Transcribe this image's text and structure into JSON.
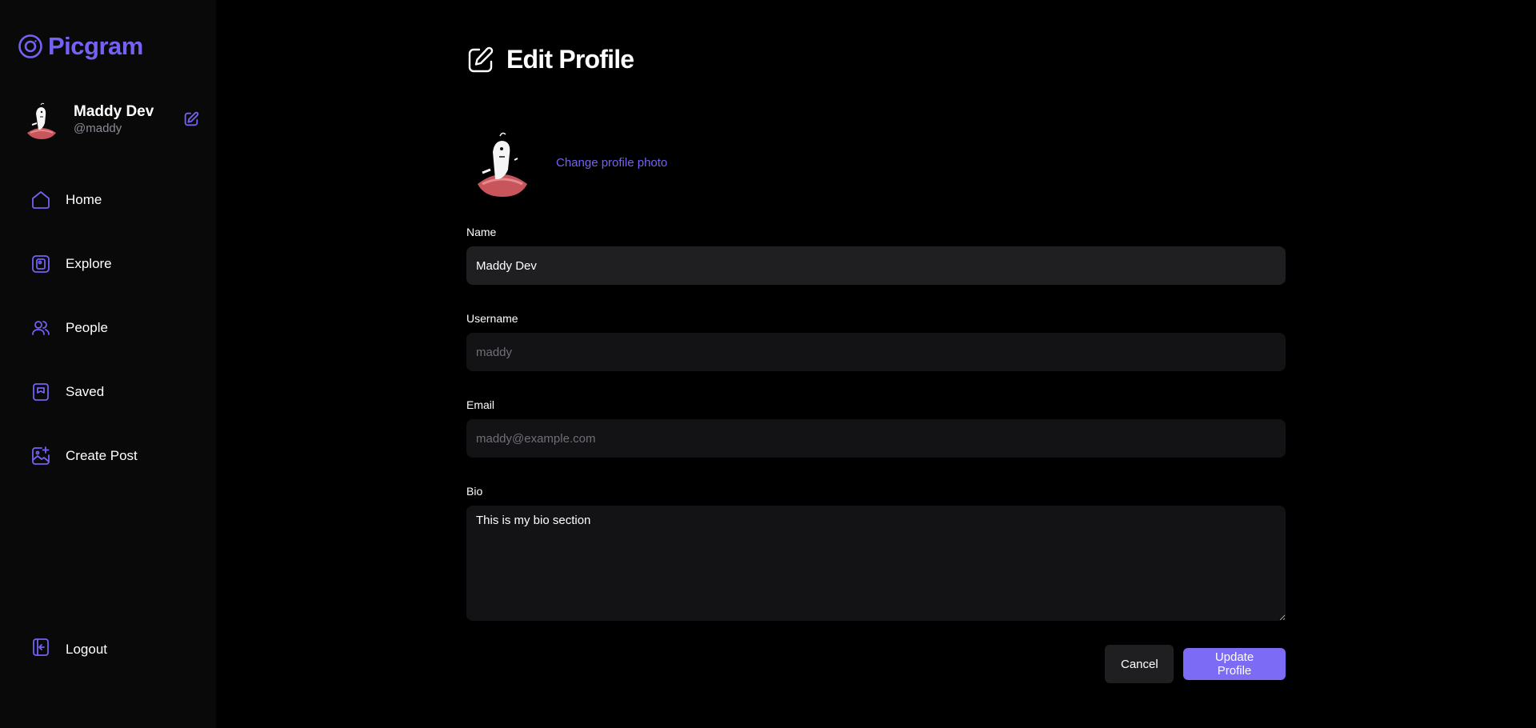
{
  "brand": {
    "name": "Picgram",
    "accent": "#7462f4"
  },
  "user": {
    "name": "Maddy Dev",
    "handle": "@maddy"
  },
  "nav": [
    {
      "label": "Home",
      "icon": "home-icon"
    },
    {
      "label": "Explore",
      "icon": "explore-icon"
    },
    {
      "label": "People",
      "icon": "people-icon"
    },
    {
      "label": "Saved",
      "icon": "bookmark-icon"
    },
    {
      "label": "Create Post",
      "icon": "create-post-icon"
    }
  ],
  "logout_label": "Logout",
  "page": {
    "title": "Edit Profile"
  },
  "photo": {
    "change_label": "Change profile photo"
  },
  "form": {
    "name": {
      "label": "Name",
      "value": "Maddy Dev"
    },
    "username": {
      "label": "Username",
      "placeholder": "maddy"
    },
    "email": {
      "label": "Email",
      "placeholder": "maddy@example.com"
    },
    "bio": {
      "label": "Bio",
      "value": "This is my bio section"
    }
  },
  "buttons": {
    "cancel": "Cancel",
    "update": "Update Profile"
  }
}
